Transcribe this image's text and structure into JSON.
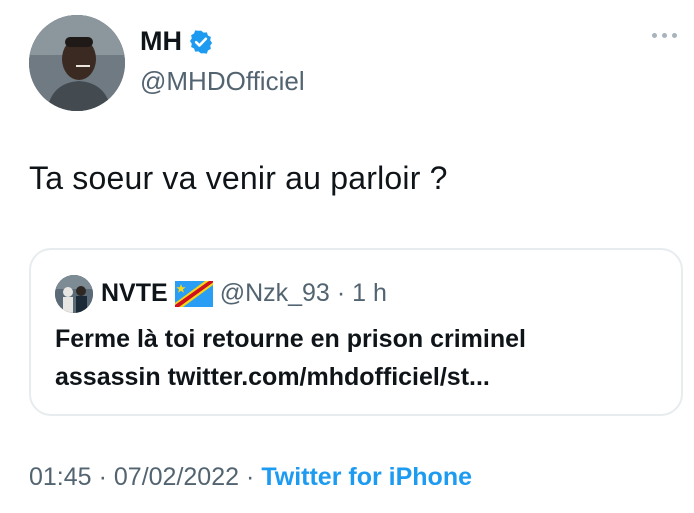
{
  "author": {
    "display_name": "MH",
    "handle": "@MHDOfficiel",
    "verified_icon": "verified-badge-icon",
    "avatar_icon": "avatar-photo"
  },
  "tweet": {
    "text": "Ta soeur va venir au parloir ?"
  },
  "quoted_tweet": {
    "display_name": "NVTE",
    "flag_icon": "dr-congo-flag-icon",
    "handle": "@Nzk_93",
    "separator": "·",
    "time": "1 h",
    "text_line1": "Ferme là toi retourne en prison criminel",
    "text_line2": "assassin twitter.com/mhdofficiel/st..."
  },
  "meta": {
    "time": "01:45",
    "separator1": "·",
    "date": "07/02/2022",
    "separator2": "·",
    "source": "Twitter for iPhone"
  },
  "colors": {
    "accent": "#1d9bf0",
    "text_primary": "#0f1419",
    "text_secondary": "#536471",
    "border": "#e7ecef"
  }
}
